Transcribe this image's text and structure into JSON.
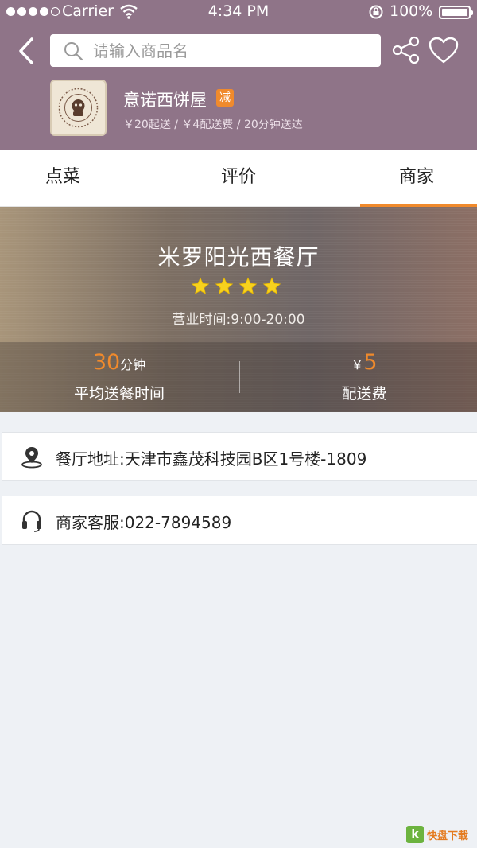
{
  "status_bar": {
    "carrier": "Carrier",
    "time": "4:34 PM",
    "battery": "100%"
  },
  "header": {
    "search_placeholder": "请输入商品名",
    "shop_name": "意诺西饼屋",
    "promo_badge": "减",
    "shop_meta": "￥20起送 / ￥4配送费 / 20分钟送达"
  },
  "tabs": [
    {
      "label": "点菜",
      "active": false
    },
    {
      "label": "评价",
      "active": false
    },
    {
      "label": "商家",
      "active": true
    }
  ],
  "banner": {
    "title": "米罗阳光西餐厅",
    "rating_stars": 4,
    "hours": "营业时间:9:00-20:00",
    "avg_delivery_value": "30",
    "avg_delivery_unit": "分钟",
    "avg_delivery_label": "平均送餐时间",
    "fee_currency": "￥",
    "fee_value": "5",
    "fee_label": "配送费"
  },
  "info": {
    "address": "餐厅地址:天津市鑫茂科技园B区1号楼-1809",
    "service": "商家客服:022-7894589"
  },
  "watermark": {
    "mark": "k",
    "text": "快盘下载"
  },
  "colors": {
    "header": "#8f7488",
    "accent": "#f08a2c",
    "background": "#eef1f5"
  }
}
